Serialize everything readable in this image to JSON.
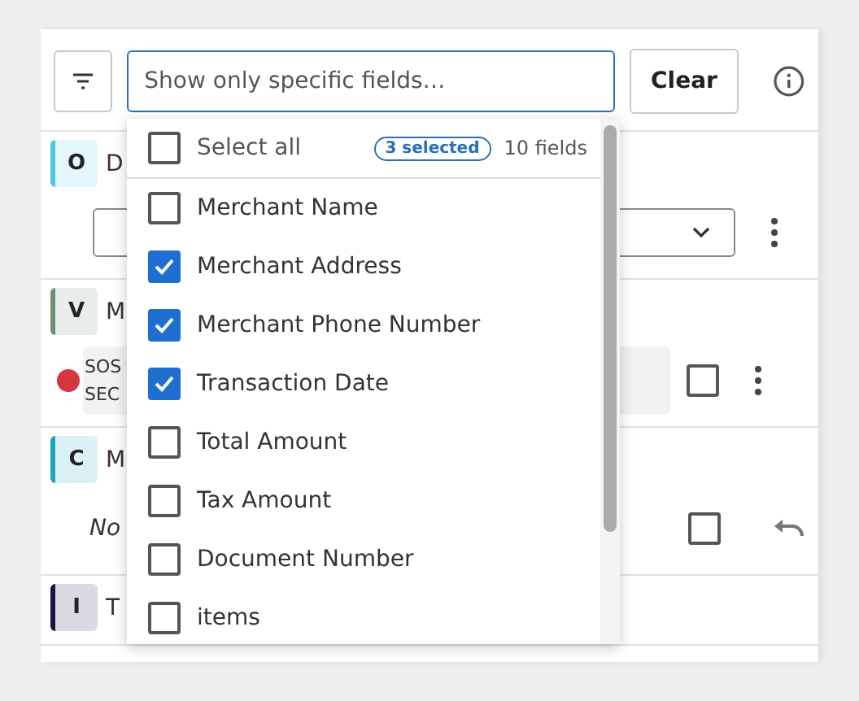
{
  "toolbar": {
    "search": {
      "placeholder": "Show only specific fields…"
    },
    "clear_button": "Clear"
  },
  "field_menu": {
    "select_all": {
      "label": "Select all",
      "checked": false
    },
    "selected_count": "3 selected",
    "field_count": "10 fields",
    "fields": [
      {
        "label": "Merchant Name",
        "checked": false
      },
      {
        "label": "Merchant Address",
        "checked": true
      },
      {
        "label": "Merchant Phone Number",
        "checked": true
      },
      {
        "label": "Transaction Date",
        "checked": true
      },
      {
        "label": "Total Amount",
        "checked": false
      },
      {
        "label": "Tax Amount",
        "checked": false
      },
      {
        "label": "Document Number",
        "checked": false
      },
      {
        "label": "items",
        "checked": false
      }
    ]
  },
  "rows": [
    {
      "kind": "select",
      "badge": "O",
      "color": "#4cc6ea",
      "title": "D"
    },
    {
      "kind": "status",
      "badge": "V",
      "color": "#6c8f6f",
      "title": "M",
      "status_dot": {
        "color": "#d6373f"
      },
      "status_lines": [
        "SOS",
        "SEC"
      ],
      "checked": false
    },
    {
      "kind": "note",
      "badge": "C",
      "color": "#1ea5c2",
      "title": "M",
      "note": "No",
      "checked": false
    },
    {
      "kind": "plain",
      "badge": "I",
      "color": "#1b1547",
      "title": "T"
    }
  ]
}
